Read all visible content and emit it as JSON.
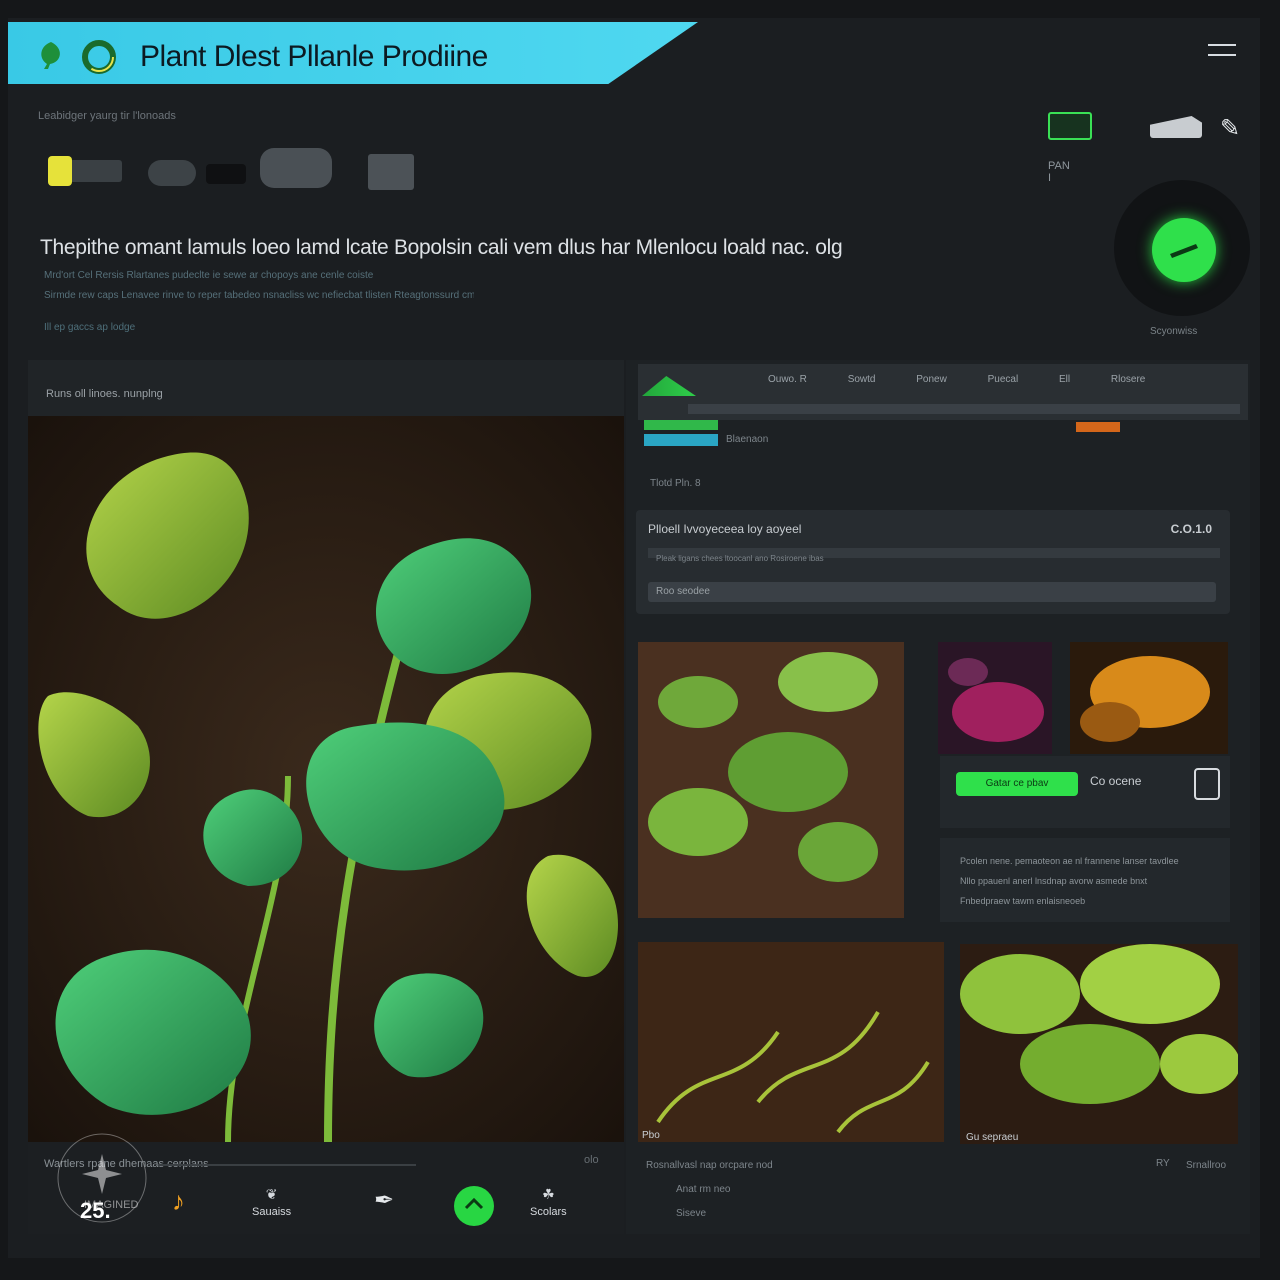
{
  "app": {
    "title": "Plant Dlest Pllanle Prodiine",
    "subheader": "Leabidger yaurg tir l'lonoads",
    "colors": {
      "accent": "#2fe04b",
      "banner": "#4fd8f0",
      "background": "#151719",
      "warning": "#d3661a"
    }
  },
  "header": {
    "menu_icon": "hamburger-icon",
    "top_right_label": "PAN I",
    "scan_label": "Scyonwiss"
  },
  "hero": {
    "headline": "Thepithe omant lamuls loeo lamd lcate Bopolsin cali vem dlus har Mlenlocu loald nac. olg",
    "sub_lines": [
      "Mrd'ort Cel Rersis Rlartanes pudeclte ie sewe ar chopoys ane cenle coiste",
      "Sirmde rew caps Lenavee rinve to reper tabedeo nsnacliss wc nefiecbat tlisten Rteagtonssurd cm hle",
      "Ill ep gaccs ap lodge"
    ]
  },
  "left_panel": {
    "header": "Runs oll linoes. nunplng",
    "caption": "Wartlers rpane dhemaas cerplans",
    "caption_right": "olo",
    "nav": [
      {
        "label": "",
        "count": "25."
      },
      {
        "label": "",
        "icon": "music-note-icon"
      },
      {
        "label": "Sauaiss",
        "icon": "leaf-icon"
      },
      {
        "label": "",
        "icon": "pen-icon"
      },
      {
        "label": "",
        "icon": "home-icon"
      },
      {
        "label": "Scolars",
        "icon": "plant-icon"
      }
    ]
  },
  "right_panel": {
    "nav_links": [
      "Ouwo. R",
      "Sowtd",
      "Ponew",
      "Puecal",
      "Ell",
      "Rlosere"
    ],
    "tab_label": "Blaenaon",
    "small_label": "Tlotd Pln. 8",
    "card": {
      "title": "Plloell Ivvoyeceea loy aoyeel",
      "value": "C.O.1.0",
      "bar_text": "Pleak ligans chees ltoocanl ano Rosiroene ibas",
      "input_value": "Roo seodee"
    },
    "action_panel": {
      "primary_button": "Gatar ce pbav",
      "secondary_button": "Co ocene"
    },
    "description": [
      "Pcolen nene. pemaoteon ae nl frannene lanser tavdlee",
      "Nllo ppauenl anerl lnsdnap avorw asmede bnxt",
      "Fnbedpraew tawm enlaisneoeb"
    ],
    "footer": {
      "line1": "Rosnallvasl nap orcpare nod",
      "line2": "Anat rm neo",
      "line3": "Siseve",
      "right_label": "RY",
      "right_label2": "Srnallroo"
    },
    "photo_caption_a": "Pbo",
    "photo_caption_b": "Gu sepraeu"
  }
}
